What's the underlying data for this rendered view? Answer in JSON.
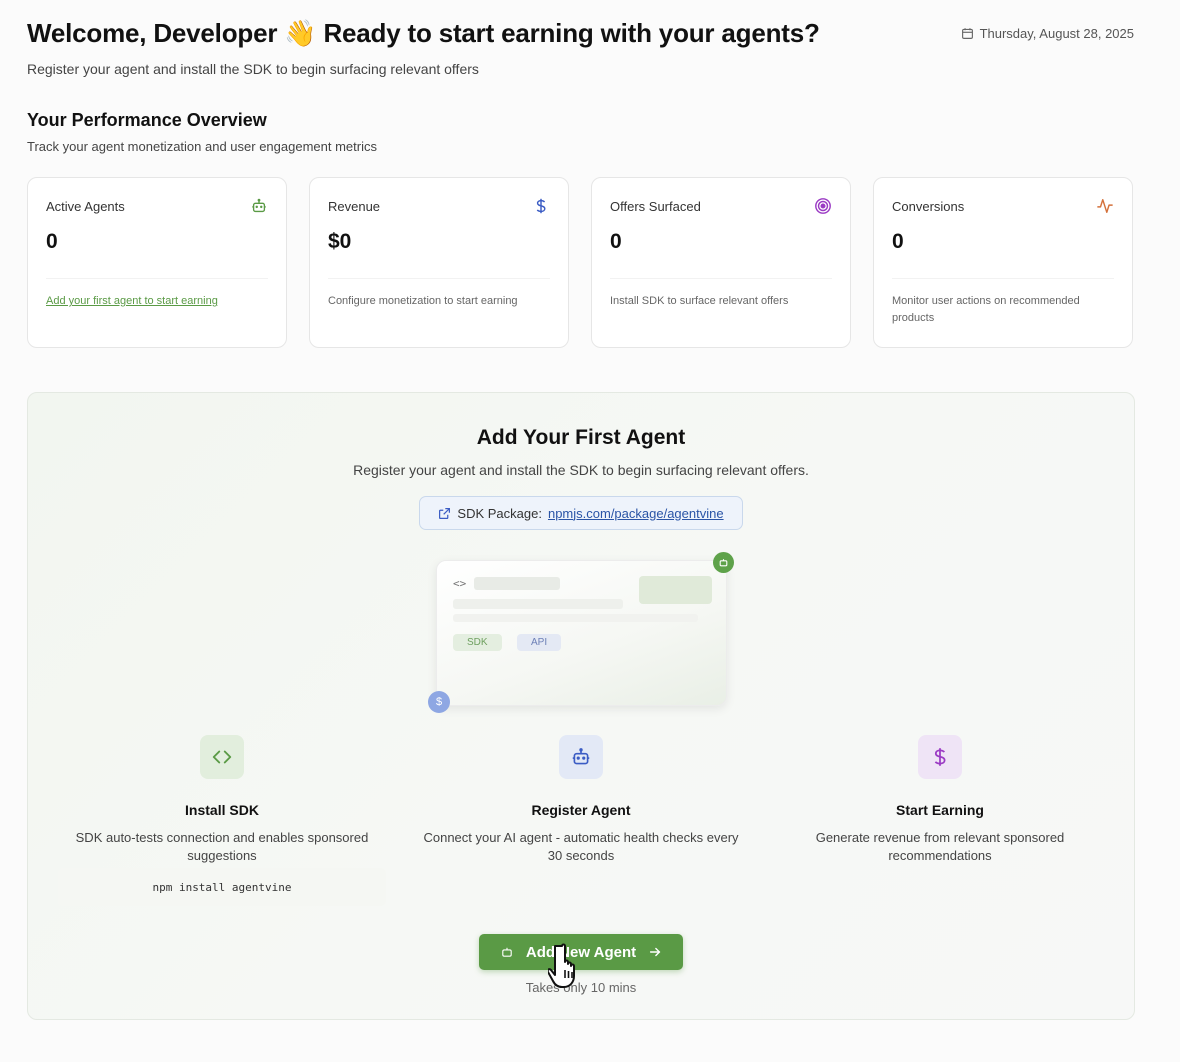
{
  "header": {
    "title": "Welcome, Developer 👋 Ready to start earning with your agents?",
    "subtitle": "Register your agent and install the SDK to begin surfacing relevant offers",
    "date": "Thursday, August 28, 2025"
  },
  "overview": {
    "title": "Your Performance Overview",
    "subtitle": "Track your agent monetization and user engagement metrics"
  },
  "cards": [
    {
      "label": "Active Agents",
      "value": "0",
      "note": "Add your first agent to start earning",
      "icon": "robot-icon",
      "color": "#5a9a45"
    },
    {
      "label": "Revenue",
      "value": "$0",
      "note": "Configure monetization to start earning",
      "icon": "dollar-icon",
      "color": "#3b5cc4"
    },
    {
      "label": "Offers Surfaced",
      "value": "0",
      "note": "Install SDK to surface relevant offers",
      "icon": "target-icon",
      "color": "#9b3bc4"
    },
    {
      "label": "Conversions",
      "value": "0",
      "note": "Monitor user actions on recommended products",
      "icon": "activity-icon",
      "color": "#d4713b"
    }
  ],
  "onboarding": {
    "title": "Add Your First Agent",
    "subtitle": "Register your agent and install the SDK to begin surfacing relevant offers.",
    "sdk_label": "SDK Package:",
    "sdk_url": "npmjs.com/package/agentvine",
    "mock_tags": [
      "SDK",
      "API"
    ],
    "mock_badge": "$",
    "steps": [
      {
        "title": "Install SDK",
        "desc": "SDK auto-tests connection and enables sponsored suggestions",
        "icon": "code-icon"
      },
      {
        "title": "Register Agent",
        "desc": "Connect your AI agent - automatic health checks every 30 seconds",
        "icon": "robot-icon"
      },
      {
        "title": "Start Earning",
        "desc": "Generate revenue from relevant sponsored recommendations",
        "icon": "dollar-icon"
      }
    ],
    "npm_command": "npm install agentvine",
    "cta_label": "Add New Agent",
    "cta_note": "Takes only 10 mins"
  }
}
